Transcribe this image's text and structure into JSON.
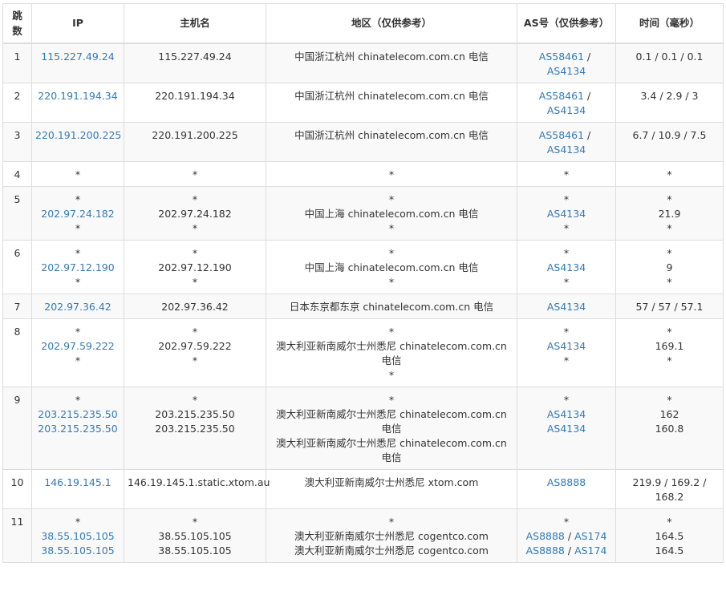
{
  "headers": {
    "hop": "跳数",
    "ip": "IP",
    "hostname": "主机名",
    "region": "地区（仅供参考）",
    "as": "AS号（仅供参考）",
    "time": "时间（毫秒）"
  },
  "rows": [
    {
      "hop": "1",
      "ip": [
        "115.227.49.24"
      ],
      "host": [
        "115.227.49.24"
      ],
      "region": [
        "中国浙江杭州 chinatelecom.com.cn 电信"
      ],
      "as": [
        [
          {
            "t": "AS58461",
            "link": true
          },
          {
            "t": " / ",
            "link": false
          }
        ],
        [
          {
            "t": "AS4134",
            "link": true
          }
        ]
      ],
      "time": [
        "0.1 / 0.1 / 0.1"
      ]
    },
    {
      "hop": "2",
      "ip": [
        "220.191.194.34"
      ],
      "host": [
        "220.191.194.34"
      ],
      "region": [
        "中国浙江杭州 chinatelecom.com.cn 电信"
      ],
      "as": [
        [
          {
            "t": "AS58461",
            "link": true
          },
          {
            "t": " / ",
            "link": false
          }
        ],
        [
          {
            "t": "AS4134",
            "link": true
          }
        ]
      ],
      "time": [
        "3.4 / 2.9 / 3"
      ]
    },
    {
      "hop": "3",
      "ip": [
        "220.191.200.225"
      ],
      "host": [
        "220.191.200.225"
      ],
      "region": [
        "中国浙江杭州 chinatelecom.com.cn 电信"
      ],
      "as": [
        [
          {
            "t": "AS58461",
            "link": true
          },
          {
            "t": " / ",
            "link": false
          }
        ],
        [
          {
            "t": "AS4134",
            "link": true
          }
        ]
      ],
      "time": [
        "6.7 / 10.9 / 7.5"
      ]
    },
    {
      "hop": "4",
      "ip": [
        "*"
      ],
      "host": [
        "*"
      ],
      "region": [
        "*"
      ],
      "as": [
        [
          {
            "t": "*",
            "link": false
          }
        ]
      ],
      "time": [
        "*"
      ]
    },
    {
      "hop": "5",
      "ip": [
        "*",
        "202.97.24.182",
        "*"
      ],
      "host": [
        "*",
        "202.97.24.182",
        "*"
      ],
      "region": [
        "*",
        "中国上海 chinatelecom.com.cn 电信",
        "*"
      ],
      "as": [
        [
          {
            "t": "*",
            "link": false
          }
        ],
        [
          {
            "t": "AS4134",
            "link": true
          }
        ],
        [
          {
            "t": "*",
            "link": false
          }
        ]
      ],
      "time": [
        "*",
        "21.9",
        "*"
      ]
    },
    {
      "hop": "6",
      "ip": [
        "*",
        "202.97.12.190",
        "*"
      ],
      "host": [
        "*",
        "202.97.12.190",
        "*"
      ],
      "region": [
        "*",
        "中国上海 chinatelecom.com.cn 电信",
        "*"
      ],
      "as": [
        [
          {
            "t": "*",
            "link": false
          }
        ],
        [
          {
            "t": "AS4134",
            "link": true
          }
        ],
        [
          {
            "t": "*",
            "link": false
          }
        ]
      ],
      "time": [
        "*",
        "9",
        "*"
      ]
    },
    {
      "hop": "7",
      "ip": [
        "202.97.36.42"
      ],
      "host": [
        "202.97.36.42"
      ],
      "region": [
        "日本东京都东京 chinatelecom.com.cn 电信"
      ],
      "as": [
        [
          {
            "t": "AS4134",
            "link": true
          }
        ]
      ],
      "time": [
        "57 / 57 / 57.1"
      ]
    },
    {
      "hop": "8",
      "ip": [
        "*",
        "202.97.59.222",
        "*"
      ],
      "host": [
        "*",
        "202.97.59.222",
        "*"
      ],
      "region": [
        "*",
        "澳大利亚新南威尔士州悉尼 chinatelecom.com.cn",
        "电信",
        "*"
      ],
      "as": [
        [
          {
            "t": "*",
            "link": false
          }
        ],
        [
          {
            "t": "AS4134",
            "link": true
          }
        ],
        [
          {
            "t": "*",
            "link": false
          }
        ]
      ],
      "time": [
        "*",
        "169.1",
        "*"
      ]
    },
    {
      "hop": "9",
      "ip": [
        "*",
        "203.215.235.50",
        "203.215.235.50"
      ],
      "host": [
        "*",
        "203.215.235.50",
        "203.215.235.50"
      ],
      "region": [
        "*",
        "澳大利亚新南威尔士州悉尼 chinatelecom.com.cn",
        "电信",
        "澳大利亚新南威尔士州悉尼 chinatelecom.com.cn",
        "电信"
      ],
      "as": [
        [
          {
            "t": "*",
            "link": false
          }
        ],
        [
          {
            "t": "AS4134",
            "link": true
          }
        ],
        [
          {
            "t": "AS4134",
            "link": true
          }
        ]
      ],
      "time": [
        "*",
        "162",
        "160.8"
      ]
    },
    {
      "hop": "10",
      "ip": [
        "146.19.145.1"
      ],
      "host": [
        "146.19.145.1.static.xtom.au"
      ],
      "region": [
        "澳大利亚新南威尔士州悉尼 xtom.com"
      ],
      "as": [
        [
          {
            "t": "AS8888",
            "link": true
          }
        ]
      ],
      "time": [
        "219.9 / 169.2 /",
        "168.2"
      ]
    },
    {
      "hop": "11",
      "ip": [
        "*",
        "38.55.105.105",
        "38.55.105.105"
      ],
      "host": [
        "*",
        "38.55.105.105",
        "38.55.105.105"
      ],
      "region": [
        "*",
        "澳大利亚新南威尔士州悉尼 cogentco.com",
        "澳大利亚新南威尔士州悉尼 cogentco.com"
      ],
      "as": [
        [
          {
            "t": "*",
            "link": false
          }
        ],
        [
          {
            "t": "AS8888",
            "link": true
          },
          {
            "t": " / ",
            "link": false
          },
          {
            "t": "AS174",
            "link": true
          }
        ],
        [
          {
            "t": "AS8888",
            "link": true
          },
          {
            "t": " / ",
            "link": false
          },
          {
            "t": "AS174",
            "link": true
          }
        ]
      ],
      "time": [
        "*",
        "164.5",
        "164.5"
      ]
    }
  ],
  "colors": {
    "link": "#337ab7",
    "text": "#333333",
    "border": "#dddddd",
    "stripe": "#f9f9f9"
  }
}
